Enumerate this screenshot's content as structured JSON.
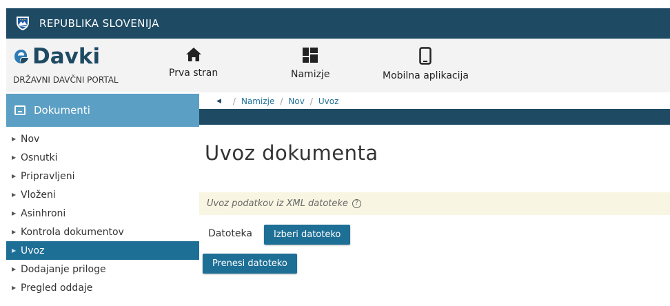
{
  "gov_bar": {
    "title": "REPUBLIKA SLOVENIJA"
  },
  "logo": {
    "brand": "Davki",
    "subtitle": "DRŽAVNI DAVČNI PORTAL"
  },
  "nav": [
    {
      "label": "Prva stran",
      "icon": "home-icon"
    },
    {
      "label": "Namizje",
      "icon": "dashboard-icon"
    },
    {
      "label": "Mobilna aplikacija",
      "icon": "mobile-phone-icon"
    }
  ],
  "sidebar": {
    "title": "Dokumenti",
    "items": [
      {
        "label": "Nov"
      },
      {
        "label": "Osnutki"
      },
      {
        "label": "Pripravljeni"
      },
      {
        "label": "Vloženi"
      },
      {
        "label": "Asinhroni"
      },
      {
        "label": "Kontrola dokumentov"
      },
      {
        "label": "Uvoz",
        "active": true
      },
      {
        "label": "Dodajanje priloge"
      },
      {
        "label": "Pregled oddaje"
      }
    ]
  },
  "breadcrumb": [
    "Namizje",
    "Nov",
    "Uvoz"
  ],
  "page": {
    "title": "Uvoz dokumenta",
    "info": "Uvoz podatkov iz XML datoteke",
    "file_label": "Datoteka",
    "pick_button": "Izberi datoteko",
    "upload_button": "Prenesi datoteko"
  },
  "colors": {
    "primary_dark": "#1e4a63",
    "accent": "#1e6f96",
    "sidebar_header": "#5b9fc4",
    "info_background": "#f8f6e2"
  }
}
